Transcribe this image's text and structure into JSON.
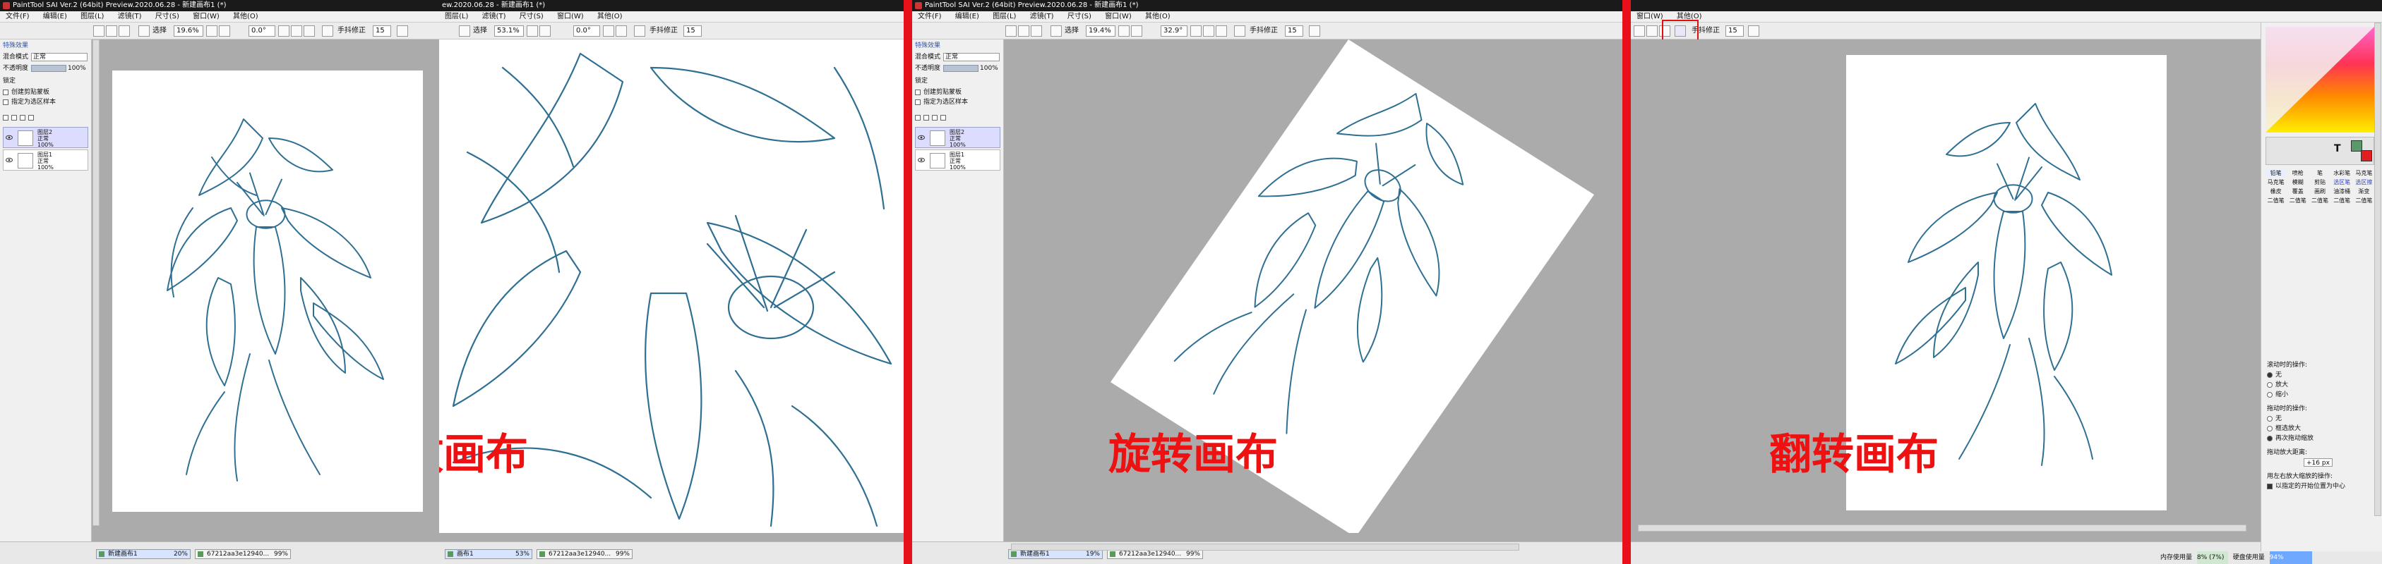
{
  "window_title": "PaintTool SAI Ver.2 (64bit) Preview.2020.06.28 - 新建画布1 (*)",
  "window_title_crop": "ew.2020.06.28 - 新建画布1 (*)",
  "menu": [
    "文件(F)",
    "编辑(E)",
    "图层(L)",
    "滤镜(T)",
    "尺寸(S)",
    "窗口(W)",
    "其他(O)"
  ],
  "menu_crop": [
    "滤镜(T)",
    "尺寸(S)",
    "窗口(W)",
    "其他(O)"
  ],
  "menu_crop2": [
    "窗口(W)",
    "其他(O)"
  ],
  "toolbar": {
    "select_label": "选择",
    "zoom_panel1": "19.6%",
    "zoom_panel2": "53.1%",
    "zoom_panel3": "19.4%",
    "angle": "0.0°",
    "angle_rotated": "32.9°",
    "stabilizer_label": "手抖修正",
    "stabilizer_value": "15"
  },
  "layer_panel": {
    "header": "特殊效果",
    "blend_label": "混合模式",
    "blend_value": "正常",
    "opacity_label": "不透明度",
    "opacity_value": "100%",
    "lock_label": "锁定",
    "clip_label": "创建剪贴蒙板",
    "ref_label": "指定为选区样本",
    "layers": [
      {
        "name": "图层2",
        "mode": "正常",
        "opacity": "100%"
      },
      {
        "name": "图层1",
        "mode": "正常",
        "opacity": "100%"
      }
    ]
  },
  "status_tabs": [
    {
      "name": "新建画布1",
      "pct": "20%"
    },
    {
      "name": "67212aa3e12940...",
      "pct": "99%"
    }
  ],
  "status_tabs_p2": [
    {
      "name": "画布1",
      "pct": "53%"
    },
    {
      "name": "67212aa3e12940...",
      "pct": "99%"
    }
  ],
  "status_tabs_p3": [
    {
      "name": "新建画布1",
      "pct": "19%"
    },
    {
      "name": "67212aa3e12940...",
      "pct": "99%"
    }
  ],
  "captions": {
    "zoom": "缩放画布",
    "rotate": "旋转画布",
    "flip": "翻转画布"
  },
  "tool_panel": {
    "tabs": [
      "铅笔",
      "喷枪",
      "笔",
      "水彩笔",
      "马克笔"
    ],
    "tools_row1": [
      "铅笔",
      "喷枪",
      "笔",
      "水彩笔",
      "马克笔"
    ],
    "tools_row2": [
      "马克笔",
      "模糊",
      "剪贴",
      "选区笔",
      "选区擦"
    ],
    "tools_row3": [
      "橡皮",
      "覆盖",
      "画刷",
      "油漆桶",
      "渐变"
    ],
    "tools_row4": [
      "二值笔",
      "二值笔",
      "二值笔",
      "二值笔",
      "二值笔"
    ],
    "scroll_label": "滚动时的操作:",
    "scroll_opts": [
      "无",
      "放大",
      "缩小"
    ],
    "drag_label": "拖动时的操作:",
    "drag_opts": [
      "无",
      "框选放大",
      "再次拖动缩放"
    ],
    "step_label": "拖动放大距离:",
    "step_value": "+16 px",
    "center_label": "用左右放大缩放的操作:",
    "center_check": "以指定的开始位置为中心"
  },
  "memory": {
    "label": "内存使用量",
    "value": "8% (7%)",
    "disk_label": "硬盘使用量",
    "disk_value": "94%"
  },
  "colors": {
    "divider": "#e8101a",
    "caption": "#ee1111",
    "line": "#2f6f92",
    "canvas_bg": "#ababab"
  }
}
